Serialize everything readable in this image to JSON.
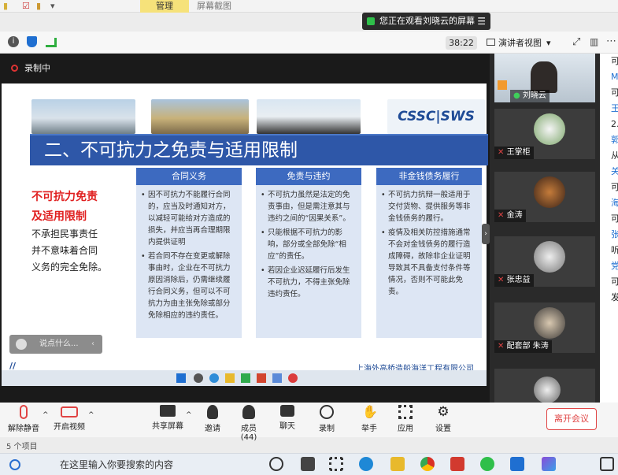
{
  "ribbon": {
    "manage_tab": "管理",
    "screenshot_tab": "屏幕截图"
  },
  "share_banner": {
    "text": "您正在观看刘晓云的屏幕"
  },
  "meeting": {
    "timer": "38:22",
    "view_mode": "演讲者视图",
    "recording_label": "录制中"
  },
  "slide": {
    "logo": "CSSC|SWS",
    "title": "二、不可抗力之免责与适用限制",
    "left_red": [
      "不可抗力免责",
      "及适用限制"
    ],
    "left_black": [
      "不承担民事责任",
      "并不意味着合同",
      "义务的完全免除。"
    ],
    "columns": [
      {
        "header": "合同义务",
        "items": [
          "因不可抗力不能履行合同的，应当及时通知对方，以减轻可能给对方造成的损失，并应当再合理期限内提供证明",
          "若合同不存在变更或解除事由时，企业在不可抗力原因消除后，仍需继续履行合同义务，但可以不可抗力为由主张免除或部分免除相应的违约责任。"
        ]
      },
      {
        "header": "免责与违约",
        "items": [
          "不可抗力虽然是法定的免责事由，但是需注意其与违约之间的“因果关系”。",
          "只能根据不可抗力的影响，部分或全部免除“相应”的责任。",
          "若因企业迟延履行后发生不可抗力，不得主张免除违约责任。"
        ]
      },
      {
        "header": "非金钱债务履行",
        "items": [
          "不可抗力抗辩一般适用于交付货物、提供服务等非金钱债务的履行。",
          "疫情及相关防控措施通常不会对金钱债务的履行造成障碍，故除非企业证明导致其不具备支付条件等情况，否则不可能此免责。"
        ]
      }
    ],
    "company": "上海外高桥造船海洋工程有限公司"
  },
  "say_box": {
    "placeholder": "说点什么..."
  },
  "participants": [
    {
      "name": "刘晓云"
    },
    {
      "name": "王掌柜"
    },
    {
      "name": "金涛"
    },
    {
      "name": "张忠益"
    },
    {
      "name": "配套部 朱涛"
    }
  ],
  "chat_fragments": [
    "可",
    "M",
    "可",
    "王",
    "2.",
    "郭",
    "从",
    "关",
    "可",
    "海",
    "可",
    "张",
    "听",
    "党",
    "可",
    "发"
  ],
  "controls": {
    "mute": "解除静音",
    "video": "开启视频",
    "share": "共享屏幕",
    "invite": "邀请",
    "members": "成员(44)",
    "chat": "聊天",
    "record": "录制",
    "raise": "举手",
    "apps": "应用",
    "settings": "设置",
    "leave": "离开会议"
  },
  "status": {
    "item_count": "5 个项目"
  },
  "taskbar": {
    "search_placeholder": "在这里输入你要搜索的内容"
  }
}
